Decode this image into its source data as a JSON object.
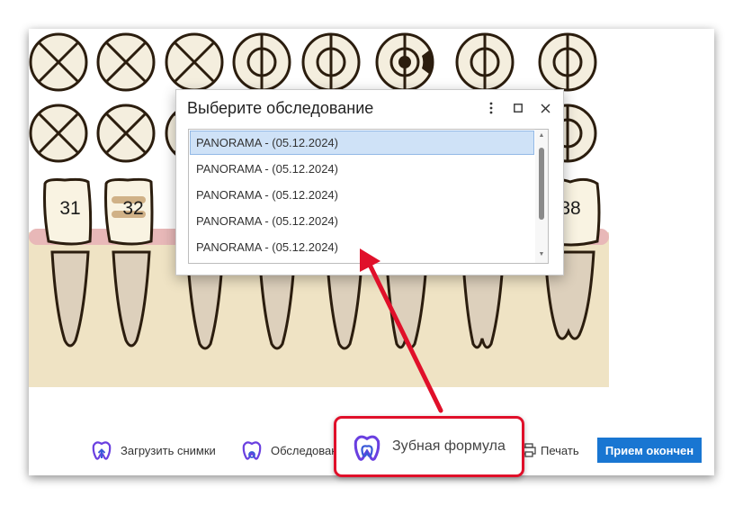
{
  "chart": {
    "teeth": [
      {
        "label": "31"
      },
      {
        "label": "32"
      },
      {
        "label": "38"
      }
    ]
  },
  "dialog": {
    "title": "Выберите обследование",
    "items": [
      "PANORAMA - (05.12.2024)",
      "PANORAMA - (05.12.2024)",
      "PANORAMA - (05.12.2024)",
      "PANORAMA - (05.12.2024)",
      "PANORAMA - (05.12.2024)"
    ],
    "selected_index": 0
  },
  "toolbar": {
    "upload_label": "Загрузить снимки",
    "exams_label": "Обследован",
    "formula_label": "Зубная формула",
    "print_label": "Печать",
    "finish_label": "Прием окончен"
  },
  "colors": {
    "accent": "#1976d2",
    "icon_purple": "#6a3fe0",
    "annotation_red": "#e0102a",
    "gum": "#e8b8b8",
    "bone": "#efe3c4"
  },
  "icons": {
    "upload": "tooth-upload-icon",
    "exams": "tooth-link-icon",
    "formula": "tooth-icon",
    "print": "printer-icon",
    "menu": "kebab-menu-icon",
    "maximize": "maximize-icon",
    "close": "close-icon"
  }
}
